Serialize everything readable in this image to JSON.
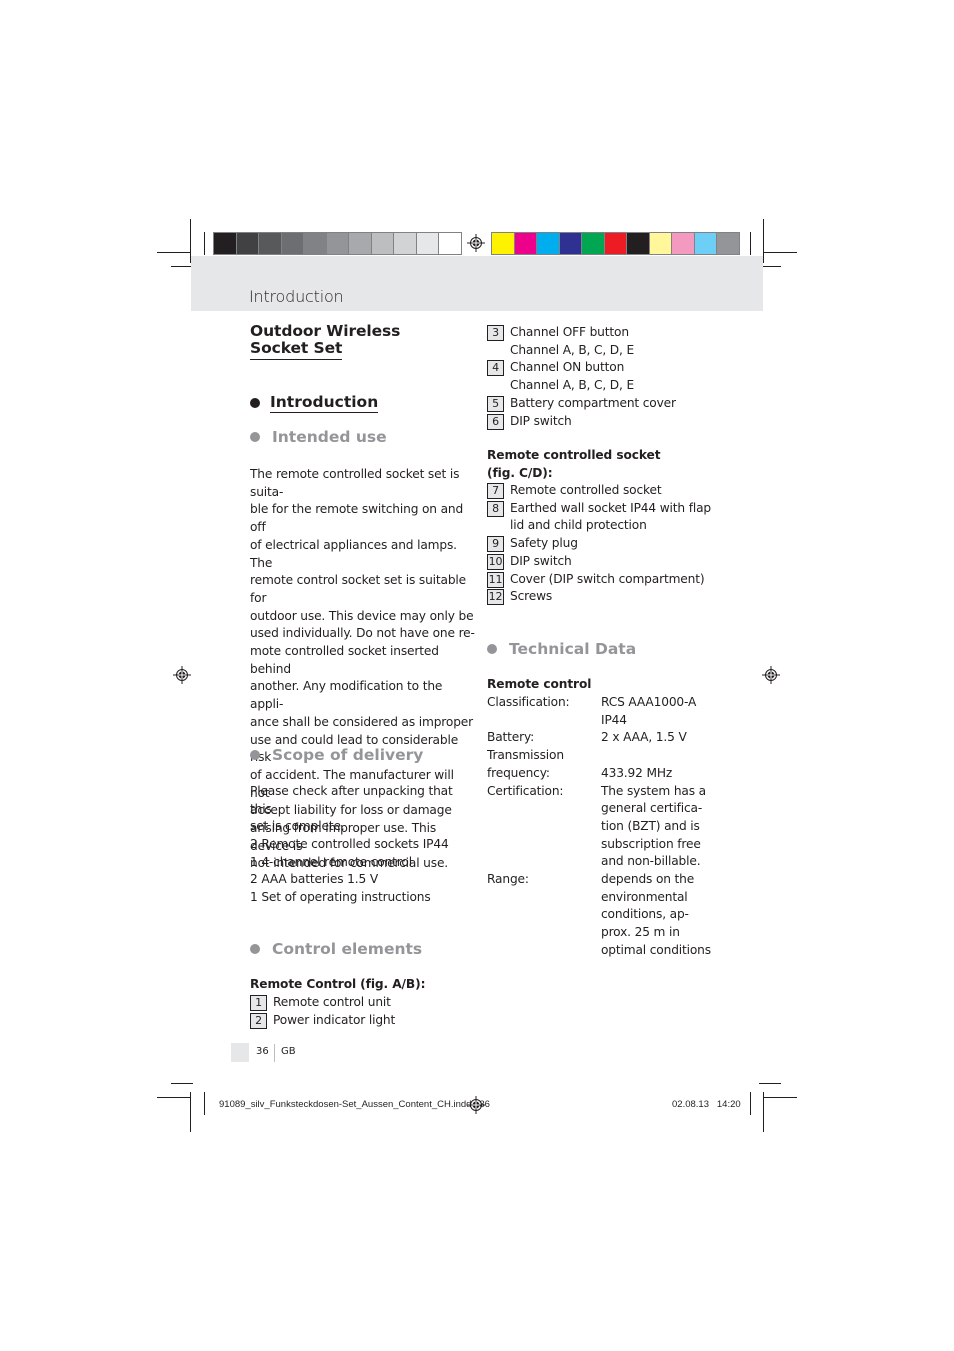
{
  "colorbar": {
    "grays": [
      "#231f20",
      "#414042",
      "#58595b",
      "#6d6e71",
      "#808285",
      "#939598",
      "#a7a9ac",
      "#bcbec0",
      "#d1d3d4",
      "#e6e7e8",
      "#ffffff"
    ],
    "colors": [
      "#fff200",
      "#ec008c",
      "#00aeef",
      "#2e3192",
      "#00a651",
      "#ed1c24",
      "#231f20",
      "#fff799",
      "#f49ac1",
      "#6dcff6",
      "#939598"
    ]
  },
  "header": {
    "title": "Introduction"
  },
  "left": {
    "product_title_line1": "Outdoor Wireless",
    "product_title_line2": "Socket Set",
    "section_introduction": "Introduction",
    "intended_use": {
      "heading": "Intended use",
      "lines": [
        "The remote controlled socket set is suita-",
        "ble for the remote switching on and off",
        "of electrical appliances and lamps. The",
        "remote control socket set is suitable for",
        "outdoor use. This device may only be",
        "used individually. Do not have one re-",
        "mote controlled socket inserted behind",
        "another. Any modification to the appli-",
        "ance shall be considered as improper",
        "use and could lead to considerable risk",
        "of accident. The manufacturer will not",
        "accept liability for loss or damage",
        "arising from improper use. This device is",
        "not intended for commercial use."
      ]
    },
    "scope": {
      "heading": "Scope of delivery",
      "intro_lines": [
        "Please check after unpacking that this",
        "set is complete."
      ],
      "items": [
        "2 Remote controlled sockets IP44",
        "1 4-channel remote control",
        "2 AAA batteries 1.5 V",
        "1 Set of operating instructions"
      ]
    },
    "control": {
      "heading": "Control elements",
      "remote_label": "Remote Control (fig. A/B):",
      "items": [
        {
          "num": "1",
          "text": "Remote control unit"
        },
        {
          "num": "2",
          "text": "Power indicator light"
        }
      ]
    }
  },
  "right": {
    "remote_items": [
      {
        "num": "3",
        "text": "Channel OFF button",
        "cont": "Channel A, B, C, D, E"
      },
      {
        "num": "4",
        "text": "Channel ON button",
        "cont": "Channel A, B, C, D, E"
      },
      {
        "num": "5",
        "text": "Battery compartment cover"
      },
      {
        "num": "6",
        "text": "DIP switch"
      }
    ],
    "socket_label_line1": "Remote controlled socket",
    "socket_label_line2": "(fig. C/D):",
    "socket_items": [
      {
        "num": "7",
        "text": "Remote controlled socket"
      },
      {
        "num": "8",
        "text": "Earthed wall socket IP44 with flap",
        "cont": "lid and child protection"
      },
      {
        "num": "9",
        "text": "Safety plug"
      },
      {
        "num": "10",
        "text": "DIP switch"
      },
      {
        "num": "11",
        "text": "Cover (DIP switch compartment)"
      },
      {
        "num": "12",
        "text": "Screws"
      }
    ],
    "tech": {
      "heading": "Technical Data",
      "subheading": "Remote control",
      "rows": [
        {
          "key": "Classification:",
          "val": [
            "RCS AAA1000-A",
            "IP44"
          ]
        },
        {
          "key": "Battery:",
          "val": [
            "2 x AAA, 1.5 V"
          ]
        },
        {
          "key": "Transmission",
          "val": [
            ""
          ]
        },
        {
          "key": "frequency:",
          "val": [
            "433.92 MHz"
          ]
        },
        {
          "key": "Certification:",
          "val": [
            "The system has a",
            "general certifica-",
            "tion (BZT) and is",
            "subscription free",
            "and non-billable."
          ]
        },
        {
          "key": "Range:",
          "val": [
            "depends on the",
            "environmental",
            "conditions, ap-",
            "prox. 25 m in",
            "optimal conditions"
          ]
        }
      ]
    }
  },
  "footer": {
    "page_number": "36",
    "language": "GB",
    "slug_file": "91089_silv_Funksteckdosen-Set_Aussen_Content_CH.indd   36",
    "slug_date": "02.08.13   14:20"
  }
}
